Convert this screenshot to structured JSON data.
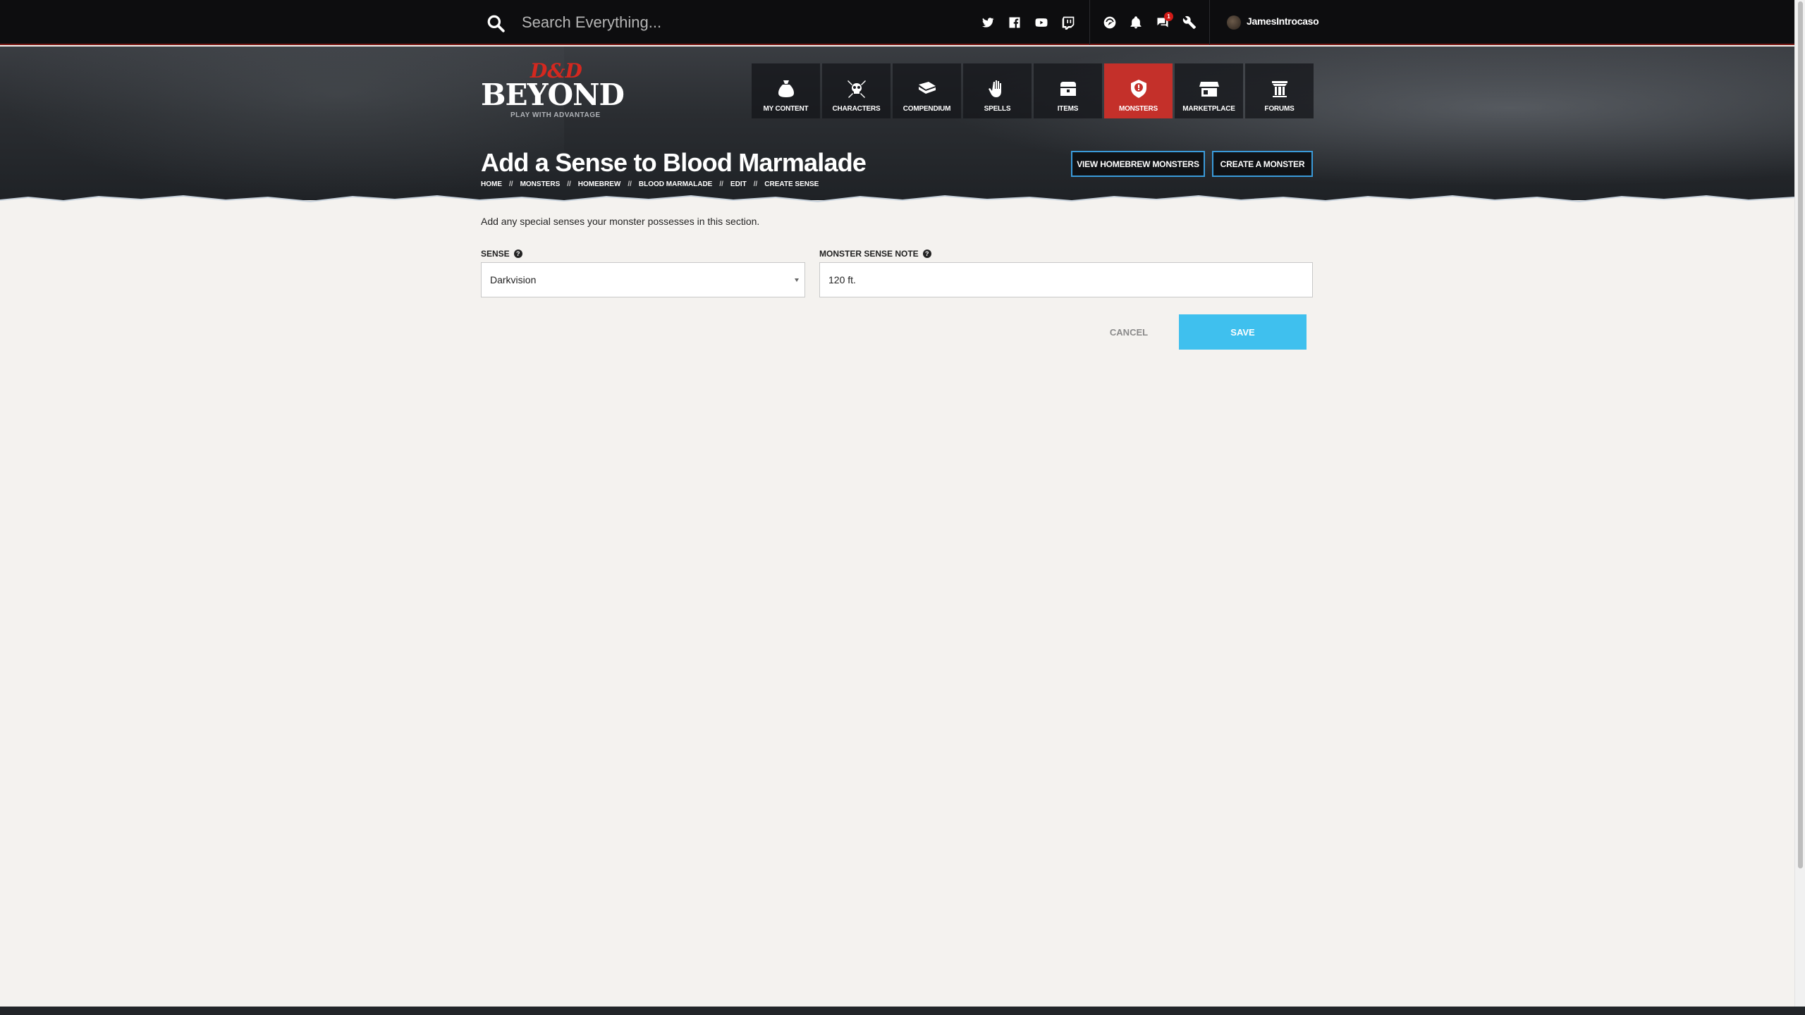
{
  "search": {
    "placeholder": "Search Everything..."
  },
  "topbar": {
    "social_icons": [
      "twitter-icon",
      "facebook-icon",
      "youtube-icon",
      "twitch-icon"
    ],
    "util_icons": [
      "compass-icon",
      "bell-icon",
      "chat-icon",
      "wrench-icon"
    ],
    "notification_count": "1",
    "username": "JamesIntrocaso"
  },
  "logo": {
    "dd": "D&D",
    "beyond": "BEYOND",
    "tagline": "PLAY WITH ADVANTAGE"
  },
  "nav": {
    "items": [
      {
        "label": "MY CONTENT",
        "icon": "bag-icon"
      },
      {
        "label": "CHARACTERS",
        "icon": "skull-swords-icon"
      },
      {
        "label": "COMPENDIUM",
        "icon": "book-icon"
      },
      {
        "label": "SPELLS",
        "icon": "hand-icon"
      },
      {
        "label": "ITEMS",
        "icon": "chest-icon"
      },
      {
        "label": "MONSTERS",
        "icon": "shield-icon",
        "active": true
      },
      {
        "label": "MARKETPLACE",
        "icon": "shop-icon"
      },
      {
        "label": "FORUMS",
        "icon": "column-icon"
      }
    ]
  },
  "page": {
    "title": "Add a Sense to Blood Marmalade",
    "breadcrumb": [
      "HOME",
      "MONSTERS",
      "HOMEBREW",
      "BLOOD MARMALADE",
      "EDIT",
      "CREATE SENSE"
    ],
    "breadcrumb_sep": "//",
    "view_homebrew_label": "VIEW HOMEBREW MONSTERS",
    "create_monster_label": "CREATE A MONSTER"
  },
  "form": {
    "intro": "Add any special senses your monster possesses in this section.",
    "sense_label": "SENSE",
    "sense_value": "Darkvision",
    "note_label": "MONSTER SENSE NOTE",
    "note_value": "120 ft.",
    "cancel_label": "CANCEL",
    "save_label": "SAVE"
  },
  "colors": {
    "accent_red": "#c4302a",
    "save_blue": "#3fc0ee",
    "outline_blue": "#3a9ad9"
  }
}
